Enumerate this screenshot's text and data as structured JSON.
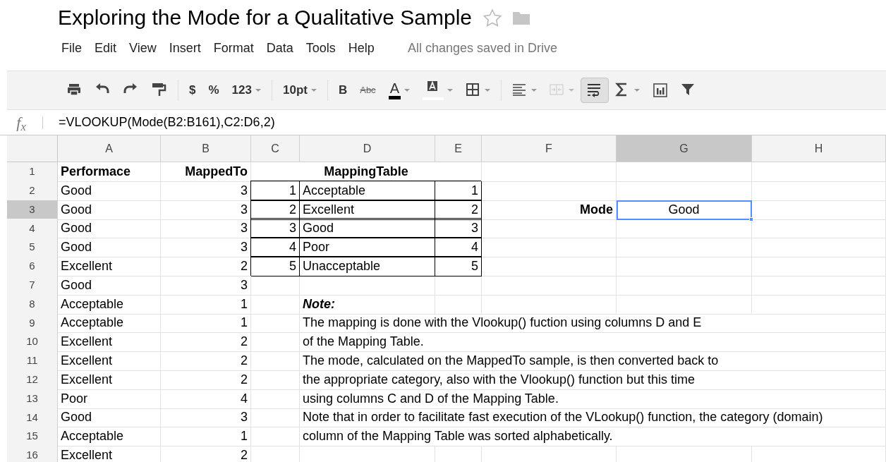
{
  "document": {
    "title": "Exploring the Mode for a Qualitative Sample",
    "starred": false
  },
  "menu": [
    "File",
    "Edit",
    "View",
    "Insert",
    "Format",
    "Data",
    "Tools",
    "Help"
  ],
  "save_status": "All changes saved in Drive",
  "toolbar": [
    {
      "kind": "print",
      "dropdown": false,
      "pressed": false,
      "disabled": false
    },
    {
      "kind": "undo",
      "dropdown": false,
      "pressed": false,
      "disabled": false
    },
    {
      "kind": "redo",
      "dropdown": false,
      "pressed": false,
      "disabled": false
    },
    {
      "kind": "paint",
      "dropdown": false,
      "pressed": false,
      "disabled": false
    },
    {
      "kind": "separator"
    },
    {
      "kind": "text",
      "label": "$",
      "dropdown": false,
      "pressed": false,
      "disabled": false
    },
    {
      "kind": "text",
      "label": "%",
      "dropdown": false,
      "pressed": false,
      "disabled": false
    },
    {
      "kind": "text",
      "label": "123",
      "dropdown": true,
      "pressed": false,
      "disabled": false
    },
    {
      "kind": "separator"
    },
    {
      "kind": "text",
      "label": "10pt",
      "dropdown": true,
      "pressed": false,
      "disabled": false
    },
    {
      "kind": "separator"
    },
    {
      "kind": "bold",
      "label": "B",
      "dropdown": false,
      "pressed": false,
      "disabled": false
    },
    {
      "kind": "strike",
      "label": "Abc",
      "dropdown": false,
      "pressed": false,
      "disabled": false
    },
    {
      "kind": "text_color",
      "label": "A",
      "color": "#000000",
      "dropdown": true,
      "pressed": false,
      "disabled": false
    },
    {
      "kind": "fill_color",
      "color": "#ffffff",
      "dropdown": true,
      "pressed": false,
      "disabled": false
    },
    {
      "kind": "borders",
      "dropdown": true,
      "pressed": false,
      "disabled": false
    },
    {
      "kind": "separator"
    },
    {
      "kind": "align",
      "dropdown": true,
      "pressed": false,
      "disabled": false
    },
    {
      "kind": "merge",
      "dropdown": true,
      "pressed": false,
      "disabled": true
    },
    {
      "kind": "wrap",
      "dropdown": false,
      "pressed": true,
      "disabled": false
    },
    {
      "kind": "sum",
      "dropdown": true,
      "pressed": false,
      "disabled": false
    },
    {
      "kind": "chart",
      "dropdown": false,
      "pressed": false,
      "disabled": false
    },
    {
      "kind": "filter",
      "dropdown": false,
      "pressed": false,
      "disabled": false
    }
  ],
  "formula_bar": {
    "label": "f$_{x}$",
    "formula": "=VLOOKUP(Mode(B2:B161),C2:D6,2)"
  },
  "columns": [
    {
      "label": "A",
      "selected": false
    },
    {
      "label": "B",
      "selected": false
    },
    {
      "label": "C",
      "selected": false
    },
    {
      "label": "D",
      "selected": false
    },
    {
      "label": "E",
      "selected": false
    },
    {
      "label": "F",
      "selected": false
    },
    {
      "label": "G",
      "selected": true
    },
    {
      "label": "H",
      "selected": false
    }
  ],
  "rows": [
    {
      "number": "1",
      "selected": false,
      "cells": {
        "A": {
          "text": "Performace",
          "kind": "heading"
        },
        "B": {
          "text": "MappedTo",
          "kind": "heading_number"
        },
        "C": {
          "text": "MappingTable",
          "kind": "merged_heading"
        }
      }
    },
    {
      "number": "2",
      "selected": false,
      "cells": {
        "A": {
          "text": "Good",
          "kind": "text"
        },
        "B": {
          "text": "3",
          "kind": "number"
        },
        "C": {
          "text": "1",
          "kind": "table_number"
        },
        "D": {
          "text": "Acceptable",
          "kind": "table_text"
        },
        "E": {
          "text": "1",
          "kind": "table_number"
        }
      }
    },
    {
      "number": "3",
      "selected": true,
      "cells": {
        "A": {
          "text": "Good",
          "kind": "text"
        },
        "B": {
          "text": "3",
          "kind": "number"
        },
        "C": {
          "text": "2",
          "kind": "table_number"
        },
        "D": {
          "text": "Excellent",
          "kind": "table_text"
        },
        "E": {
          "text": "2",
          "kind": "table_number"
        },
        "F": {
          "text": "Mode",
          "kind": "heading_number"
        },
        "G": {
          "text": "Good",
          "kind": "result",
          "selected": true
        }
      }
    },
    {
      "number": "4",
      "selected": false,
      "cells": {
        "A": {
          "text": "Good",
          "kind": "text"
        },
        "B": {
          "text": "3",
          "kind": "number"
        },
        "C": {
          "text": "3",
          "kind": "table_number"
        },
        "D": {
          "text": "Good",
          "kind": "table_text"
        },
        "E": {
          "text": "3",
          "kind": "table_number"
        }
      }
    },
    {
      "number": "5",
      "selected": false,
      "cells": {
        "A": {
          "text": "Good",
          "kind": "text"
        },
        "B": {
          "text": "3",
          "kind": "number"
        },
        "C": {
          "text": "4",
          "kind": "table_number"
        },
        "D": {
          "text": "Poor",
          "kind": "table_text"
        },
        "E": {
          "text": "4",
          "kind": "table_number"
        }
      }
    },
    {
      "number": "6",
      "selected": false,
      "cells": {
        "A": {
          "text": "Excellent",
          "kind": "text"
        },
        "B": {
          "text": "2",
          "kind": "number"
        },
        "C": {
          "text": "5",
          "kind": "table_number"
        },
        "D": {
          "text": "Unacceptable",
          "kind": "table_text"
        },
        "E": {
          "text": "5",
          "kind": "table_number"
        }
      }
    },
    {
      "number": "7",
      "selected": false,
      "cells": {
        "A": {
          "text": "Good",
          "kind": "text"
        },
        "B": {
          "text": "3",
          "kind": "number"
        }
      }
    },
    {
      "number": "8",
      "selected": false,
      "cells": {
        "A": {
          "text": "Acceptable",
          "kind": "text"
        },
        "B": {
          "text": "1",
          "kind": "number"
        },
        "D": {
          "text": "Note:",
          "kind": "note_heading"
        }
      }
    },
    {
      "number": "9",
      "selected": false,
      "cells": {
        "A": {
          "text": "Acceptable",
          "kind": "text"
        },
        "B": {
          "text": "1",
          "kind": "number"
        },
        "D": {
          "text": "The mapping is done with the Vlookup() fuction using columns D and E",
          "kind": "note"
        }
      }
    },
    {
      "number": "10",
      "selected": false,
      "cells": {
        "A": {
          "text": "Excellent",
          "kind": "text"
        },
        "B": {
          "text": "2",
          "kind": "number"
        },
        "D": {
          "text": "of the Mapping Table.",
          "kind": "note"
        }
      }
    },
    {
      "number": "11",
      "selected": false,
      "cells": {
        "A": {
          "text": "Excellent",
          "kind": "text"
        },
        "B": {
          "text": "2",
          "kind": "number"
        },
        "D": {
          "text": "The mode, calculated on the MappedTo sample, is then converted back to",
          "kind": "note"
        }
      }
    },
    {
      "number": "12",
      "selected": false,
      "cells": {
        "A": {
          "text": "Excellent",
          "kind": "text"
        },
        "B": {
          "text": "2",
          "kind": "number"
        },
        "D": {
          "text": "the appropriate category, also with the Vlookup() function but this time",
          "kind": "note"
        }
      }
    },
    {
      "number": "13",
      "selected": false,
      "cells": {
        "A": {
          "text": "Poor",
          "kind": "text"
        },
        "B": {
          "text": "4",
          "kind": "number"
        },
        "D": {
          "text": "using columns C and D of the Mapping Table.",
          "kind": "note"
        }
      }
    },
    {
      "number": "14",
      "selected": false,
      "cells": {
        "A": {
          "text": "Good",
          "kind": "text"
        },
        "B": {
          "text": "3",
          "kind": "number"
        },
        "D": {
          "text": "Note that in order to facilitate fast execution of the VLookup() function, the category (domain)",
          "kind": "note"
        }
      }
    },
    {
      "number": "15",
      "selected": false,
      "cells": {
        "A": {
          "text": "Acceptable",
          "kind": "text"
        },
        "B": {
          "text": "1",
          "kind": "number"
        },
        "D": {
          "text": "column of the Mapping Table was sorted alphabetically.",
          "kind": "note"
        }
      }
    },
    {
      "number": "16",
      "selected": false,
      "cells": {
        "A": {
          "text": "Excellent",
          "kind": "text"
        },
        "B": {
          "text": "2",
          "kind": "number"
        }
      }
    }
  ]
}
